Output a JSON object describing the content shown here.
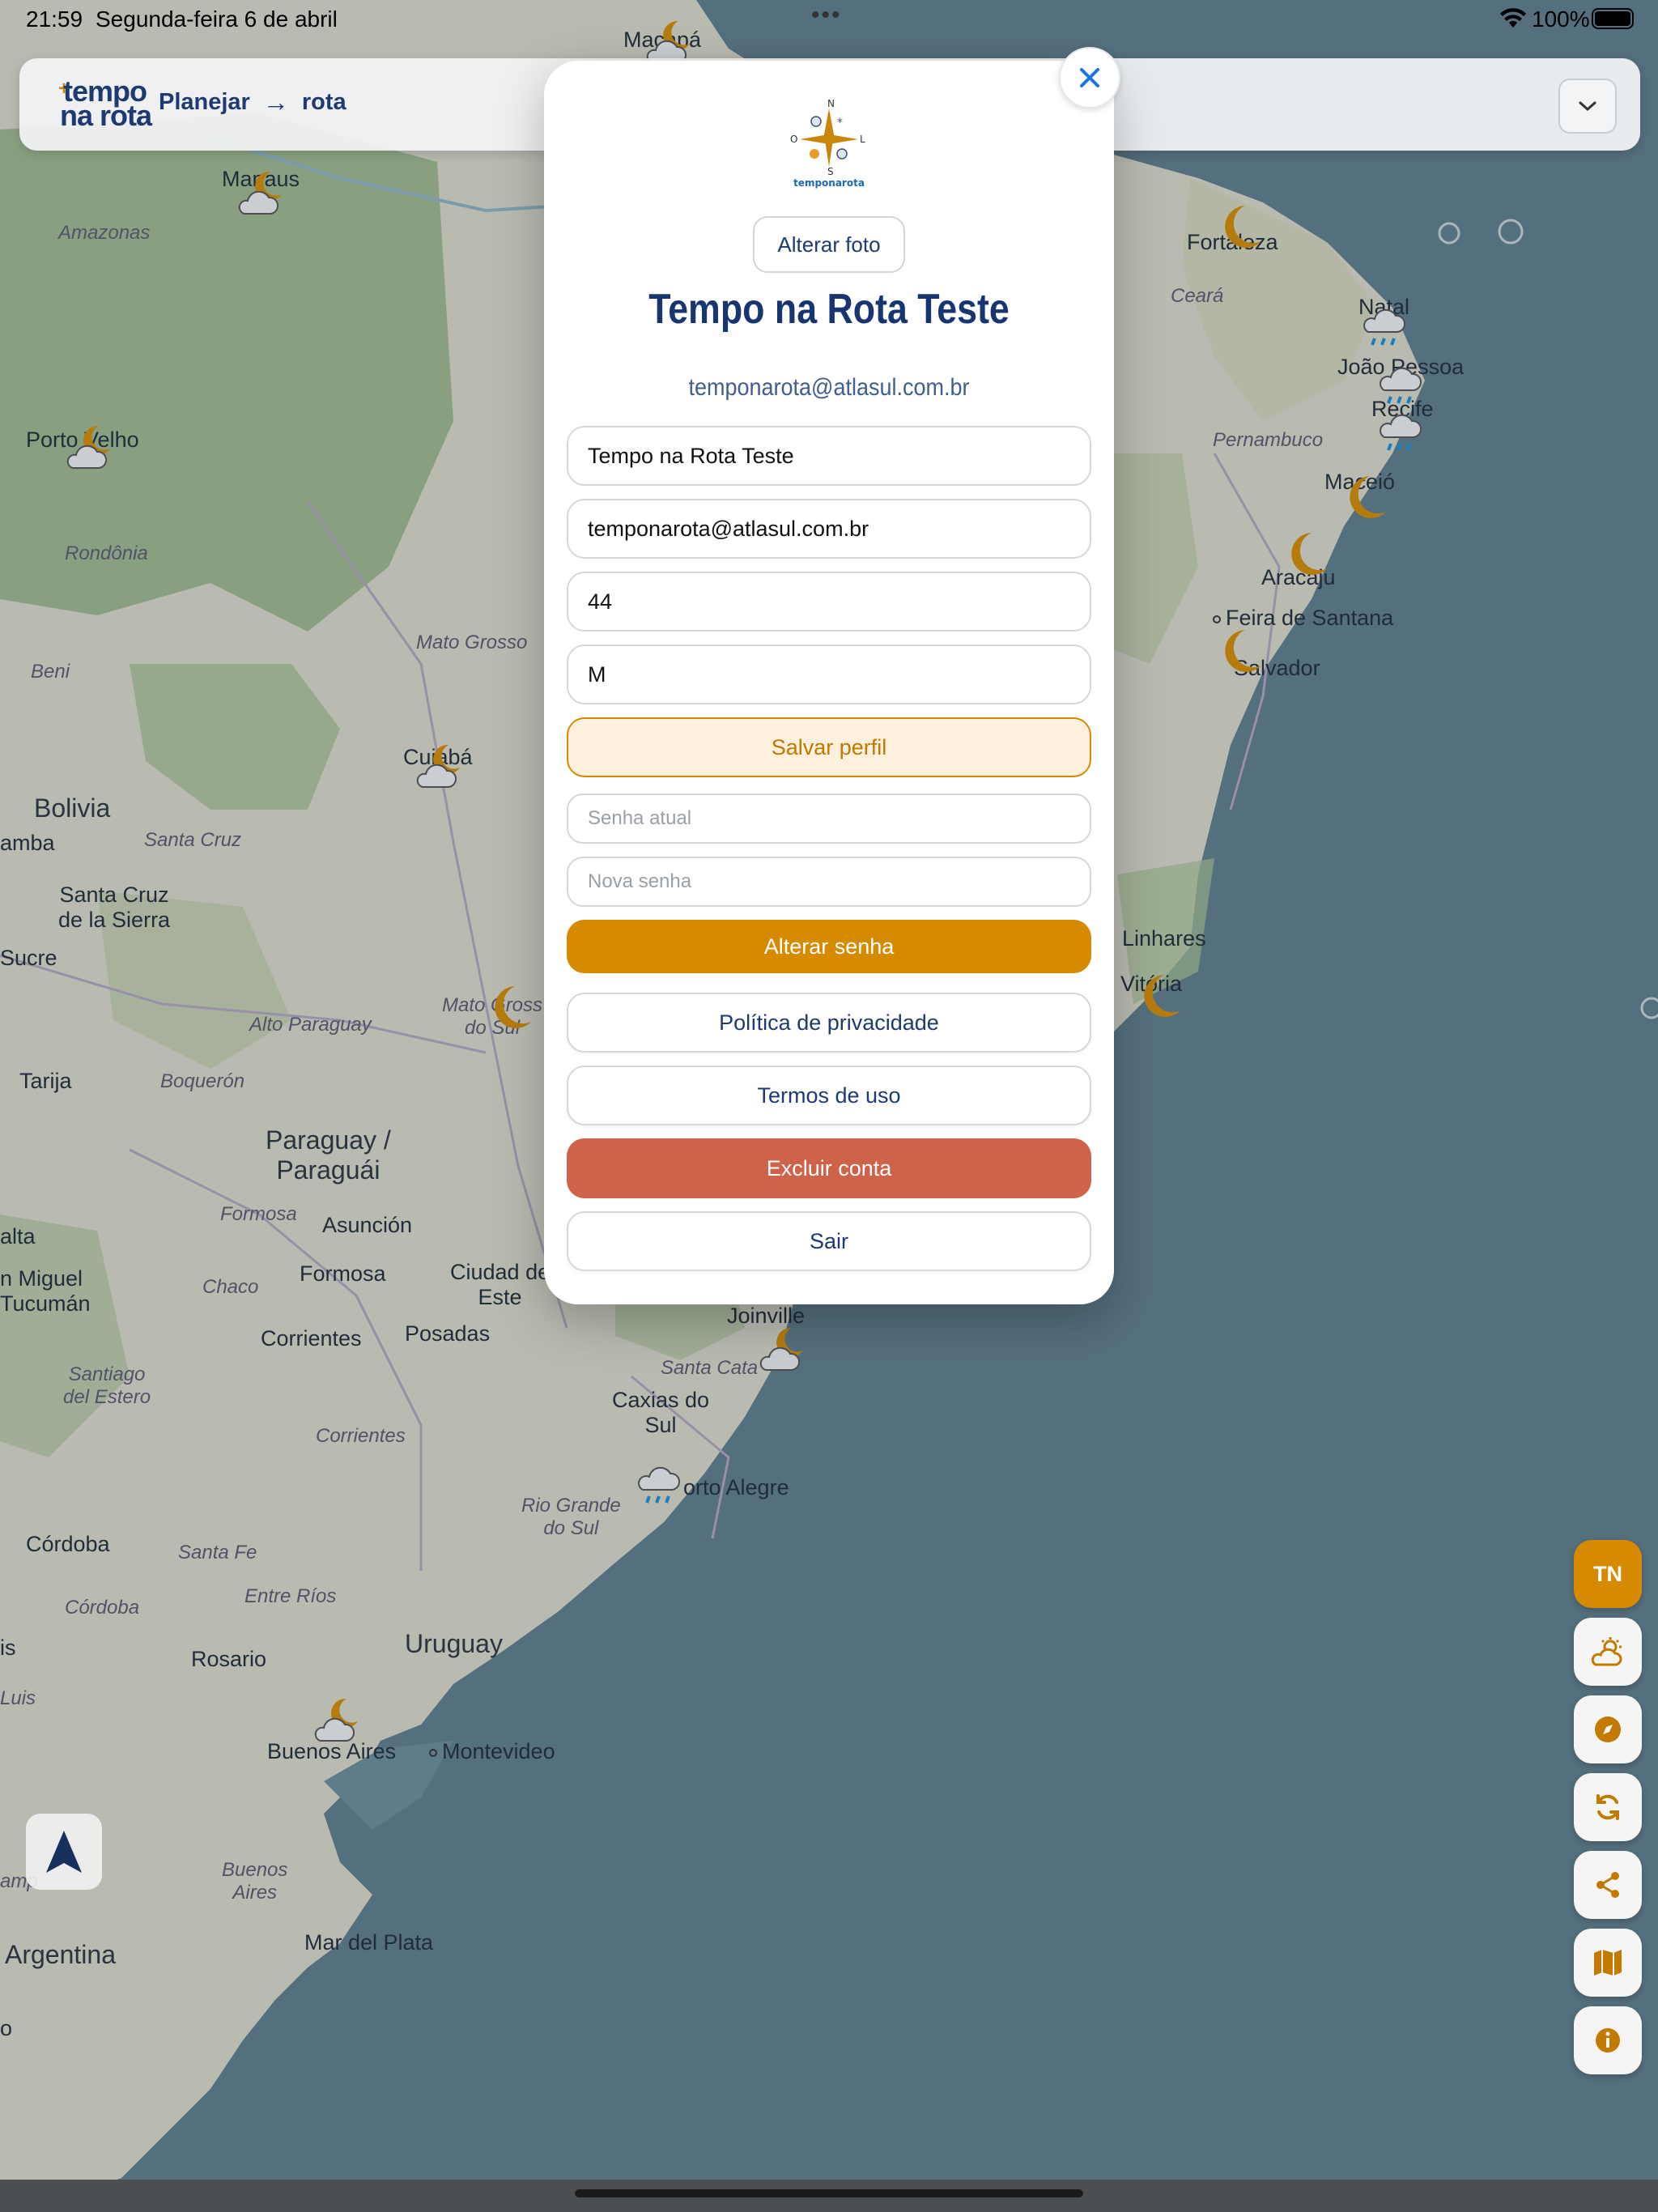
{
  "status_bar": {
    "time": "21:59",
    "date": "Segunda-feira 6 de abril",
    "battery": "100%"
  },
  "header": {
    "logo_line1": "tempo",
    "logo_line2": "na rota",
    "breadcrumb_from": "Planejar",
    "breadcrumb_to": "rota"
  },
  "modal": {
    "brand_label": "temponarota",
    "compass": {
      "n": "N",
      "s": "S",
      "l": "L",
      "o": "O"
    },
    "change_photo_label": "Alterar foto",
    "profile_name": "Tempo na Rota Teste",
    "profile_email": "temponarota@atlasul.com.br",
    "fields": {
      "name": "Tempo na Rota Teste",
      "email": "temponarota@atlasul.com.br",
      "age": "44",
      "gender": "M"
    },
    "save_profile_label": "Salvar perfil",
    "current_password_placeholder": "Senha atual",
    "new_password_placeholder": "Nova senha",
    "change_password_label": "Alterar senha",
    "privacy_label": "Política de privacidade",
    "terms_label": "Termos de uso",
    "delete_account_label": "Excluir conta",
    "logout_label": "Sair"
  },
  "rail": {
    "avatar_initials": "TN",
    "icons": [
      "weather-icon",
      "compass-icon",
      "refresh-icon",
      "share-icon",
      "map-icon",
      "info-icon"
    ]
  },
  "map": {
    "places": [
      {
        "id": "macapa",
        "label": "Macapá"
      },
      {
        "id": "manaus",
        "label": "Manaus"
      },
      {
        "id": "amazonas",
        "label": "Amazonas"
      },
      {
        "id": "porto-velho",
        "label": "Porto Velho"
      },
      {
        "id": "rondonia",
        "label": "Rondônia"
      },
      {
        "id": "beni",
        "label": "Beni"
      },
      {
        "id": "mato-grosso",
        "label": "Mato Grosso"
      },
      {
        "id": "cuiaba",
        "label": "Cuiabá"
      },
      {
        "id": "bolivia",
        "label": "Bolivia"
      },
      {
        "id": "amba",
        "label": "amba"
      },
      {
        "id": "santa-cruz-reg",
        "label": "Santa Cruz"
      },
      {
        "id": "santa-cruz-city",
        "label": "Santa Cruz\nde la Sierra"
      },
      {
        "id": "sucre",
        "label": "Sucre"
      },
      {
        "id": "tarija",
        "label": "Tarija"
      },
      {
        "id": "alto-paraguay",
        "label": "Alto Paraguay"
      },
      {
        "id": "boqueron",
        "label": "Boquerón"
      },
      {
        "id": "ms",
        "label": "Mato Gross\ndo Sul"
      },
      {
        "id": "paraguay",
        "label": "Paraguay /\nParaguái"
      },
      {
        "id": "formosa-reg",
        "label": "Formosa"
      },
      {
        "id": "asuncion",
        "label": "Asunción"
      },
      {
        "id": "salta",
        "label": "alta"
      },
      {
        "id": "chaco",
        "label": "Chaco"
      },
      {
        "id": "formosa-city",
        "label": "Formosa"
      },
      {
        "id": "ciudad-este",
        "label": "Ciudad de\nEste"
      },
      {
        "id": "miguel-tucuman",
        "label": "n Miguel\nTucumán"
      },
      {
        "id": "corrientes",
        "label": "Corrientes"
      },
      {
        "id": "posadas",
        "label": "Posadas"
      },
      {
        "id": "santiago",
        "label": "Santiago\ndel Estero"
      },
      {
        "id": "corrientes-reg",
        "label": "Corrientes"
      },
      {
        "id": "joinville",
        "label": "Joinville"
      },
      {
        "id": "santa-cata",
        "label": "Santa Cata"
      },
      {
        "id": "caxias",
        "label": "Caxias do\nSul"
      },
      {
        "id": "porto-alegre",
        "label": "orto Alegre"
      },
      {
        "id": "rio-grande",
        "label": "Rio Grande\ndo Sul"
      },
      {
        "id": "cordoba",
        "label": "Córdoba"
      },
      {
        "id": "santa-fe",
        "label": "Santa Fe"
      },
      {
        "id": "cordoba-reg",
        "label": "Córdoba"
      },
      {
        "id": "entre-rios",
        "label": "Entre Ríos"
      },
      {
        "id": "uruguay",
        "label": "Uruguay"
      },
      {
        "id": "rosario",
        "label": "Rosario"
      },
      {
        "id": "is",
        "label": "is"
      },
      {
        "id": "luis",
        "label": "Luis"
      },
      {
        "id": "buenos-aires",
        "label": "Buenos Aires"
      },
      {
        "id": "montevideo",
        "label": "Montevideo"
      },
      {
        "id": "buenos-aires-reg",
        "label": "Buenos\nAires"
      },
      {
        "id": "amp",
        "label": "amp"
      },
      {
        "id": "argentina",
        "label": "Argentina"
      },
      {
        "id": "mar-del-plata",
        "label": "Mar del Plata"
      },
      {
        "id": "fortaleza",
        "label": "Fortaleza"
      },
      {
        "id": "ceara",
        "label": "Ceará"
      },
      {
        "id": "natal",
        "label": "Natal"
      },
      {
        "id": "joao-pessoa",
        "label": "João Pessoa"
      },
      {
        "id": "recife",
        "label": "Recife"
      },
      {
        "id": "pernambuco",
        "label": "Pernambuco"
      },
      {
        "id": "maceio",
        "label": "Maceió"
      },
      {
        "id": "aracaju",
        "label": "Aracaju"
      },
      {
        "id": "feira",
        "label": "Feira de Santana"
      },
      {
        "id": "salvador",
        "label": "Salvador"
      },
      {
        "id": "linhares",
        "label": "Linhares"
      },
      {
        "id": "vitoria",
        "label": "Vitória"
      },
      {
        "id": "o",
        "label": "o"
      }
    ]
  }
}
